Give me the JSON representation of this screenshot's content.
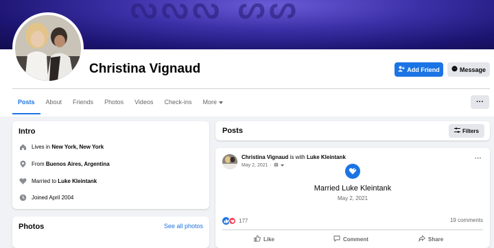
{
  "profile": {
    "name": "Christina Vignaud",
    "add_friend_label": "Add Friend",
    "message_label": "Message",
    "more_actions_label": "···"
  },
  "tabs": [
    {
      "label": "Posts",
      "active": true
    },
    {
      "label": "About"
    },
    {
      "label": "Friends"
    },
    {
      "label": "Photos"
    },
    {
      "label": "Videos"
    },
    {
      "label": "Check-ins"
    },
    {
      "label": "More"
    }
  ],
  "intro": {
    "title": "Intro",
    "lives": {
      "prefix": "Lives in ",
      "value": "New York, New York"
    },
    "from": {
      "prefix": "From ",
      "value": "Buenos Aires, Argentina"
    },
    "married": {
      "prefix": "Married to ",
      "value": "Luke Kleintank"
    },
    "joined": "Joined April 2004"
  },
  "photos": {
    "title": "Photos",
    "see_all": "See all photos"
  },
  "posts": {
    "title": "Posts",
    "filters_label": "Filters",
    "post": {
      "author": "Christina Vignaud",
      "with_text": " is with ",
      "tagged": "Luke Kleintank",
      "date": "May 2, 2021",
      "dots": "···",
      "event_title": "Married Luke Kleintank",
      "event_date": "May 2, 2021",
      "reaction_count": "177",
      "comments": "19 comments",
      "like_label": "Like",
      "comment_label": "Comment",
      "share_label": "Share"
    }
  },
  "colors": {
    "accent": "#1b74e4",
    "love": "#f33e58",
    "cover_dark": "#1c1470"
  }
}
